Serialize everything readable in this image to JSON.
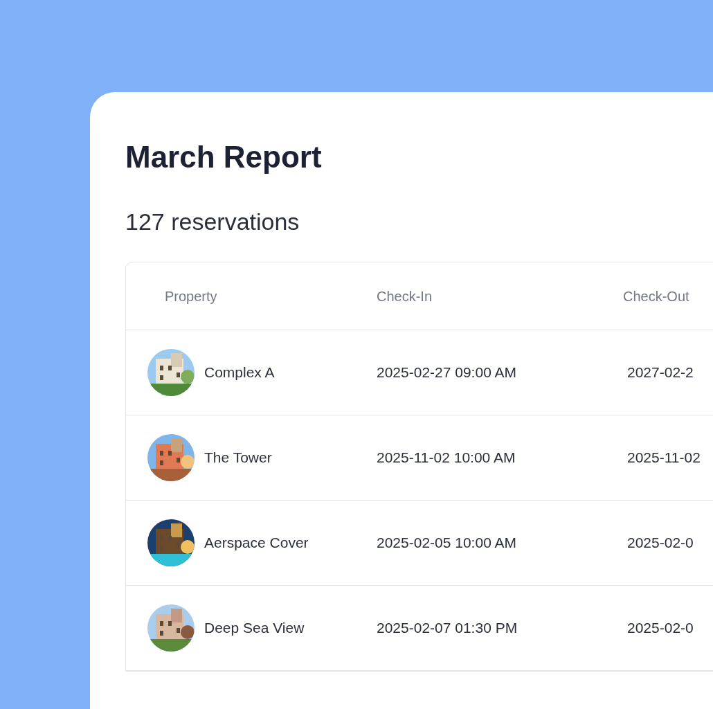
{
  "title": "March Report",
  "subtitle": "127 reservations",
  "table": {
    "columns": [
      "Property",
      "Check-In",
      "Check-Out"
    ],
    "rows": [
      {
        "property": "Complex A",
        "check_in": "2025-02-27 09:00 AM",
        "check_out": "2027-02-2"
      },
      {
        "property": "The Tower",
        "check_in": "2025-11-02 10:00 AM",
        "check_out": "2025-11-02"
      },
      {
        "property": "Aerspace Cover",
        "check_in": "2025-02-05 10:00 AM",
        "check_out": "2025-02-0"
      },
      {
        "property": "Deep Sea View",
        "check_in": "2025-02-07 01:30 PM",
        "check_out": "2025-02-0"
      }
    ]
  }
}
